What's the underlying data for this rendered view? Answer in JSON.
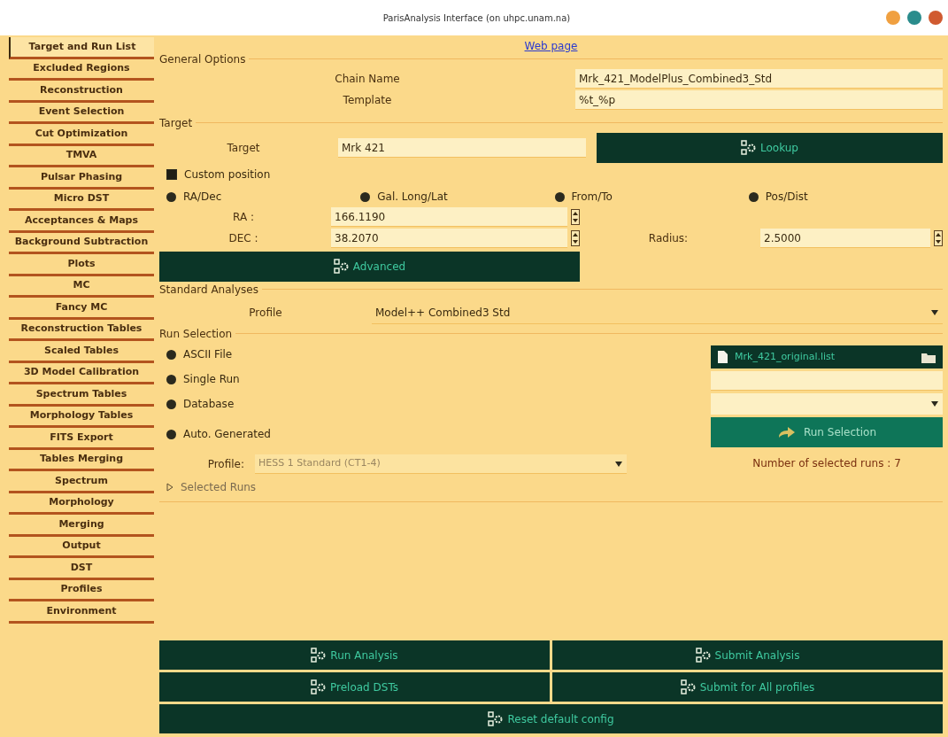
{
  "window": {
    "title": "ParisAnalysis Interface (on uhpc.unam.na)",
    "controls": [
      {
        "color": "#f0a040"
      },
      {
        "color": "#2a8c8c"
      },
      {
        "color": "#d05a30"
      }
    ]
  },
  "sidebar": {
    "tabs": [
      {
        "label": "Target and Run List",
        "selected": true
      },
      {
        "label": "Excluded Regions",
        "selected": false
      },
      {
        "label": "Reconstruction",
        "selected": false
      },
      {
        "label": "Event Selection",
        "selected": false
      },
      {
        "label": "Cut Optimization",
        "selected": false
      },
      {
        "label": "TMVA",
        "selected": false
      },
      {
        "label": "Pulsar Phasing",
        "selected": false
      },
      {
        "label": "Micro DST",
        "selected": false
      },
      {
        "label": "Acceptances & Maps",
        "selected": false
      },
      {
        "label": "Background Subtraction",
        "selected": false
      },
      {
        "label": "Plots",
        "selected": false
      },
      {
        "label": "MC",
        "selected": false
      },
      {
        "label": "Fancy MC",
        "selected": false
      },
      {
        "label": "Reconstruction Tables",
        "selected": false
      },
      {
        "label": "Scaled Tables",
        "selected": false
      },
      {
        "label": "3D Model Calibration",
        "selected": false
      },
      {
        "label": "Spectrum Tables",
        "selected": false
      },
      {
        "label": "Morphology Tables",
        "selected": false
      },
      {
        "label": "FITS Export",
        "selected": false
      },
      {
        "label": "Tables Merging",
        "selected": false
      },
      {
        "label": "Spectrum",
        "selected": false
      },
      {
        "label": "Morphology",
        "selected": false
      },
      {
        "label": "Merging",
        "selected": false
      },
      {
        "label": "Output",
        "selected": false
      },
      {
        "label": "DST",
        "selected": false
      },
      {
        "label": "Profiles",
        "selected": false
      },
      {
        "label": "Environment",
        "selected": false
      }
    ]
  },
  "web_link": "Web page",
  "general_options": {
    "title": "General Options",
    "fields": [
      {
        "label": "Chain Name",
        "value": "Mrk_421_ModelPlus_Combined3_Std"
      },
      {
        "label": "Template",
        "value": "%t_%p"
      }
    ]
  },
  "target": {
    "title": "Target",
    "target_label": "Target",
    "target_value": "Mrk 421",
    "lookup_button": "Lookup",
    "custom_position": {
      "label": "Custom position",
      "checked": true
    },
    "coord_options": [
      {
        "label": "RA/Dec",
        "selected": true
      },
      {
        "label": "Gal. Long/Lat",
        "selected": true
      },
      {
        "label": "From/To",
        "selected": true
      },
      {
        "label": "Pos/Dist",
        "selected": true
      }
    ],
    "ra": {
      "label": "RA :",
      "value": "166.1190"
    },
    "dec": {
      "label": "DEC :",
      "value": "38.2070"
    },
    "radius": {
      "label": "Radius:",
      "value": "2.5000"
    },
    "advanced_button": "Advanced"
  },
  "standard_analyses": {
    "title": "Standard Analyses",
    "profile_label": "Profile",
    "profile_value": "Model++ Combined3 Std"
  },
  "run_selection": {
    "title": "Run Selection",
    "sources": [
      {
        "label": "ASCII File",
        "selected": true
      },
      {
        "label": "Single Run",
        "selected": true
      },
      {
        "label": "Database",
        "selected": true
      },
      {
        "label": "Auto. Generated",
        "selected": true
      }
    ],
    "file_button": "Mrk_421_original.list",
    "run_selection_button": "Run Selection",
    "profile_label": "Profile:",
    "profile_value": "HESS 1 Standard (CT1-4)",
    "profile_disabled": true,
    "selected_runs": {
      "label": "Selected Runs",
      "expanded": false
    },
    "count": "Number of selected runs : 7"
  },
  "actions": [
    "Run Analysis",
    "Submit Analysis",
    "Preload DSTs",
    "Submit for All profiles",
    "Reset default config"
  ]
}
